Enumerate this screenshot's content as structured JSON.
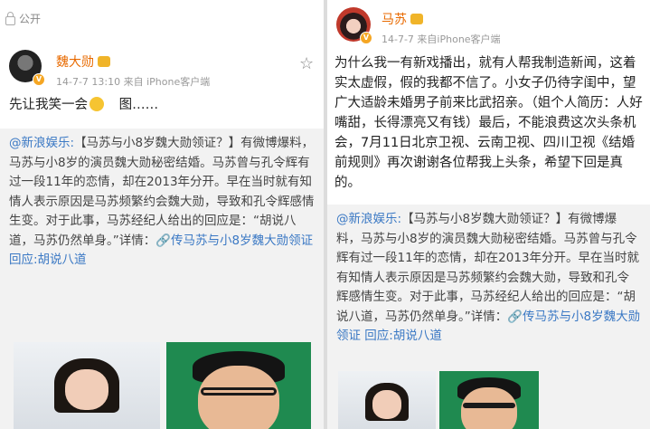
{
  "left": {
    "public_label": "公开",
    "username": "魏大勋",
    "meta": "14-7-7 13:10 来自 iPhone客户端",
    "post_before_emoji": "先让我笑一会",
    "post_after_emoji": "图……",
    "repost_source": "@新浪娱乐:",
    "repost_body": "【马苏与小8岁魏大勋领证？】有微博爆料，马苏与小8岁的演员魏大勋秘密结婚。马苏曾与孔令辉有过一段11年的恋情，却在2013年分开。早在当时就有知情人表示原因是马苏频繁约会魏大勋，导致和孔令辉感情生变。对于此事，马苏经纪人给出的回应是：“胡说八道，马苏仍然单身。”详情：",
    "repost_link": "🔗传马苏与小8岁魏大勋领证 回应:胡说八道"
  },
  "right": {
    "username": "马苏",
    "meta": "14-7-7 来自iPhone客户端",
    "post_text": "为什么我一有新戏播出，就有人帮我制造新闻，这着实太虚假，假的我都不信了。小女子仍待字闺中，望广大适龄未婚男子前来比武招亲。（姐个人简历：人好嘴甜，长得漂亮又有钱）最后，不能浪费这次头条机会，7月11日北京卫视、云南卫视、四川卫视《结婚前规则》再次谢谢各位帮我上头条，希望下回是真的。",
    "repost_source": "@新浪娱乐:",
    "repost_body": "【马苏与小8岁魏大勋领证？】有微博爆料，马苏与小8岁的演员魏大勋秘密结婚。马苏曾与孔令辉有过一段11年的恋情，却在2013年分开。早在当时就有知情人表示原因是马苏频繁约会魏大勋，导致和孔令辉感情生变。对于此事，马苏经纪人给出的回应是：“胡说八道，马苏仍然单身。”详情：",
    "repost_link": "🔗传马苏与小8岁魏大勋领证 回应:胡说八道"
  },
  "colors": {
    "username": "#e86a00",
    "link": "#3a78c4",
    "repost_bg": "#f2f2f2"
  },
  "icons": [
    "lock-icon",
    "verified-badge-icon",
    "crown-icon",
    "star-icon",
    "grin-emoji-icon",
    "link-icon"
  ]
}
